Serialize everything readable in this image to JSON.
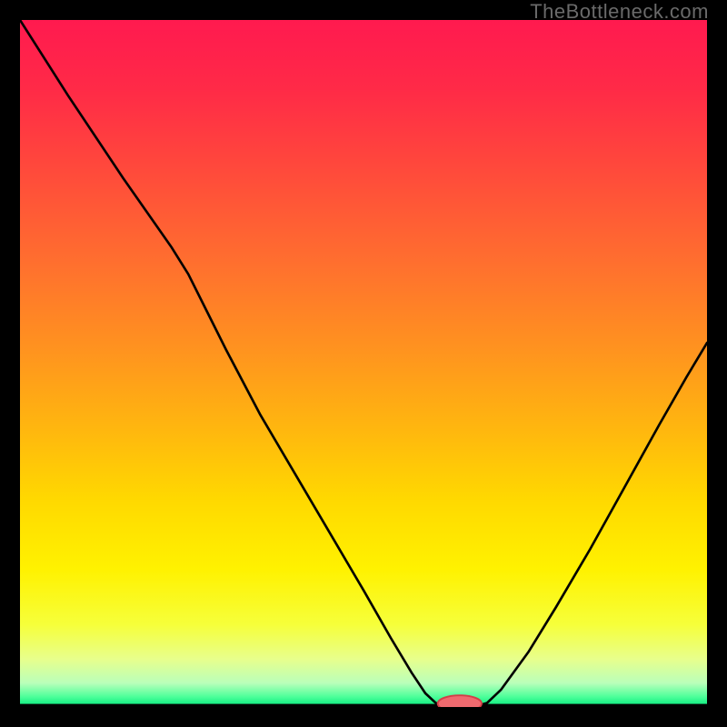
{
  "watermark": "TheBottleneck.com",
  "colors": {
    "black": "#000000",
    "curve": "#000000",
    "marker_fill": "#ef6a6f",
    "marker_stroke": "#d23f48"
  },
  "chart_data": {
    "type": "line",
    "title": "",
    "xlabel": "",
    "ylabel": "",
    "xlim": [
      0,
      100
    ],
    "ylim": [
      0,
      100
    ],
    "gradient_stops": [
      {
        "offset": 0.0,
        "color": "#ff1a4f"
      },
      {
        "offset": 0.1,
        "color": "#ff2a47"
      },
      {
        "offset": 0.22,
        "color": "#ff4a3b"
      },
      {
        "offset": 0.35,
        "color": "#ff6e2f"
      },
      {
        "offset": 0.48,
        "color": "#ff931f"
      },
      {
        "offset": 0.6,
        "color": "#ffb80e"
      },
      {
        "offset": 0.7,
        "color": "#ffd900"
      },
      {
        "offset": 0.8,
        "color": "#fff200"
      },
      {
        "offset": 0.88,
        "color": "#f6ff3a"
      },
      {
        "offset": 0.93,
        "color": "#e8ff8c"
      },
      {
        "offset": 0.965,
        "color": "#baffba"
      },
      {
        "offset": 0.985,
        "color": "#4dff9a"
      },
      {
        "offset": 1.0,
        "color": "#00e87a"
      }
    ],
    "curve_points": [
      {
        "x": 0.0,
        "y": 100.0
      },
      {
        "x": 7.0,
        "y": 89.0
      },
      {
        "x": 15.0,
        "y": 77.0
      },
      {
        "x": 22.0,
        "y": 67.0
      },
      {
        "x": 24.5,
        "y": 63.0
      },
      {
        "x": 27.0,
        "y": 58.0
      },
      {
        "x": 30.0,
        "y": 52.0
      },
      {
        "x": 35.0,
        "y": 42.5
      },
      {
        "x": 40.0,
        "y": 34.0
      },
      {
        "x": 45.0,
        "y": 25.5
      },
      {
        "x": 50.0,
        "y": 17.0
      },
      {
        "x": 54.0,
        "y": 10.0
      },
      {
        "x": 57.0,
        "y": 5.0
      },
      {
        "x": 59.0,
        "y": 2.0
      },
      {
        "x": 60.5,
        "y": 0.6
      },
      {
        "x": 62.0,
        "y": 0.0
      },
      {
        "x": 66.0,
        "y": 0.0
      },
      {
        "x": 68.0,
        "y": 0.6
      },
      {
        "x": 70.0,
        "y": 2.5
      },
      {
        "x": 74.0,
        "y": 8.0
      },
      {
        "x": 78.0,
        "y": 14.5
      },
      {
        "x": 83.0,
        "y": 23.0
      },
      {
        "x": 88.0,
        "y": 32.0
      },
      {
        "x": 93.0,
        "y": 41.0
      },
      {
        "x": 97.0,
        "y": 48.0
      },
      {
        "x": 100.0,
        "y": 53.0
      }
    ],
    "marker": {
      "x": 64.0,
      "y": 0.0,
      "rx": 3.2,
      "ry": 1.2
    }
  }
}
